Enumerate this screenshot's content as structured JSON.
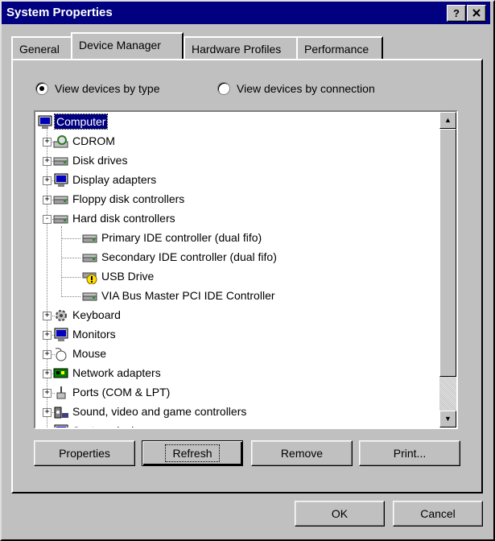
{
  "window": {
    "title": "System Properties",
    "help_label": "?",
    "close_label": "x"
  },
  "tabs": [
    {
      "label": "General"
    },
    {
      "label": "Device Manager"
    },
    {
      "label": "Hardware Profiles"
    },
    {
      "label": "Performance"
    }
  ],
  "radios": {
    "by_type": "View devices by type",
    "by_connection": "View devices by connection"
  },
  "tree": {
    "items": [
      {
        "label": "Computer",
        "icon": "computer-icon"
      },
      {
        "label": "CDROM",
        "icon": "cdrom-icon"
      },
      {
        "label": "Disk drives",
        "icon": "disk-drive-icon"
      },
      {
        "label": "Display adapters",
        "icon": "display-adapter-icon"
      },
      {
        "label": "Floppy disk controllers",
        "icon": "floppy-controller-icon"
      },
      {
        "label": "Hard disk controllers",
        "icon": "hard-disk-controller-icon"
      },
      {
        "label": "Primary IDE controller (dual fifo)",
        "icon": "ide-controller-icon"
      },
      {
        "label": "Secondary IDE controller (dual fifo)",
        "icon": "ide-controller-icon"
      },
      {
        "label": "USB Drive",
        "icon": "warning-device-icon"
      },
      {
        "label": "VIA Bus Master PCI IDE Controller",
        "icon": "ide-controller-icon"
      },
      {
        "label": "Keyboard",
        "icon": "keyboard-icon"
      },
      {
        "label": "Monitors",
        "icon": "monitor-icon"
      },
      {
        "label": "Mouse",
        "icon": "mouse-icon"
      },
      {
        "label": "Network adapters",
        "icon": "network-adapter-icon"
      },
      {
        "label": "Ports (COM & LPT)",
        "icon": "port-icon"
      },
      {
        "label": "Sound, video and game controllers",
        "icon": "sound-icon"
      },
      {
        "label": "System devices",
        "icon": "system-device-icon"
      }
    ]
  },
  "buttons": {
    "properties": "Properties",
    "refresh": "Refresh",
    "remove": "Remove",
    "print": "Print...",
    "ok": "OK",
    "cancel": "Cancel"
  },
  "colors": {
    "titlebar": "#000080",
    "face": "#c0c0c0",
    "selection": "#000080"
  }
}
